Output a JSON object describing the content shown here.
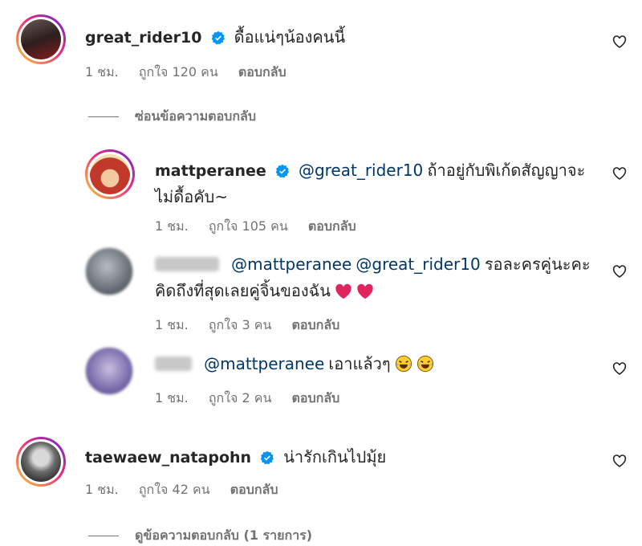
{
  "comments": [
    {
      "username": "great_rider10",
      "text": "ดื้อแน่ๆน้องคนนี้",
      "time": "1 ชม.",
      "likes": "ถูกใจ 120 คน",
      "reply_label": "ตอบกลับ",
      "verified": true,
      "avatar_color": "#3a2a2a"
    },
    {
      "username": "mattperanee",
      "mention": "@great_rider10",
      "text_line1": "ถ้าอยู่กับพิเก้ดสัญญาจะ",
      "text_line2": "ไม่ดื้อคับ~",
      "time": "1 ชม.",
      "likes": "ถูกใจ 105 คน",
      "reply_label": "ตอบกลับ",
      "verified": true,
      "avatar_color": "#c0392b"
    },
    {
      "mention1": "@mattperanee",
      "mention2": "@great_rider10",
      "text_line1": "รอละครคู่นะคะ",
      "text_line2": "คิดถึงที่สุดเลยคู่จิ้นของฉัน",
      "time": "1 ชม.",
      "likes": "ถูกใจ 3 คน",
      "reply_label": "ตอบกลับ",
      "avatar_color": "#8a8f9a"
    },
    {
      "mention": "@mattperanee",
      "text": "เอาแล้วๆ",
      "time": "1 ชม.",
      "likes": "ถูกใจ 2 คน",
      "reply_label": "ตอบกลับ",
      "avatar_color": "#7b6fa8"
    },
    {
      "username": "taewaew_natapohn",
      "text": "น่ารักเกินไปมุ้ย",
      "time": "1 ชม.",
      "likes": "ถูกใจ 42 คน",
      "reply_label": "ตอบกลับ",
      "verified": true,
      "avatar_color": "#555555"
    }
  ],
  "thread_controls": {
    "hide_replies": "ซ่อนข้อความตอบกลับ",
    "view_replies": "ดูข้อความตอบกลับ (1 รายการ)"
  },
  "colors": {
    "verified_blue": "#0095f6",
    "meta_gray": "#737373",
    "mention_blue": "#00376b",
    "heart_red": "#e0245e"
  },
  "icons": [
    "verified-badge-icon",
    "heart-outline-icon",
    "red-heart-emoji-icon",
    "laughing-tears-emoji-icon"
  ]
}
